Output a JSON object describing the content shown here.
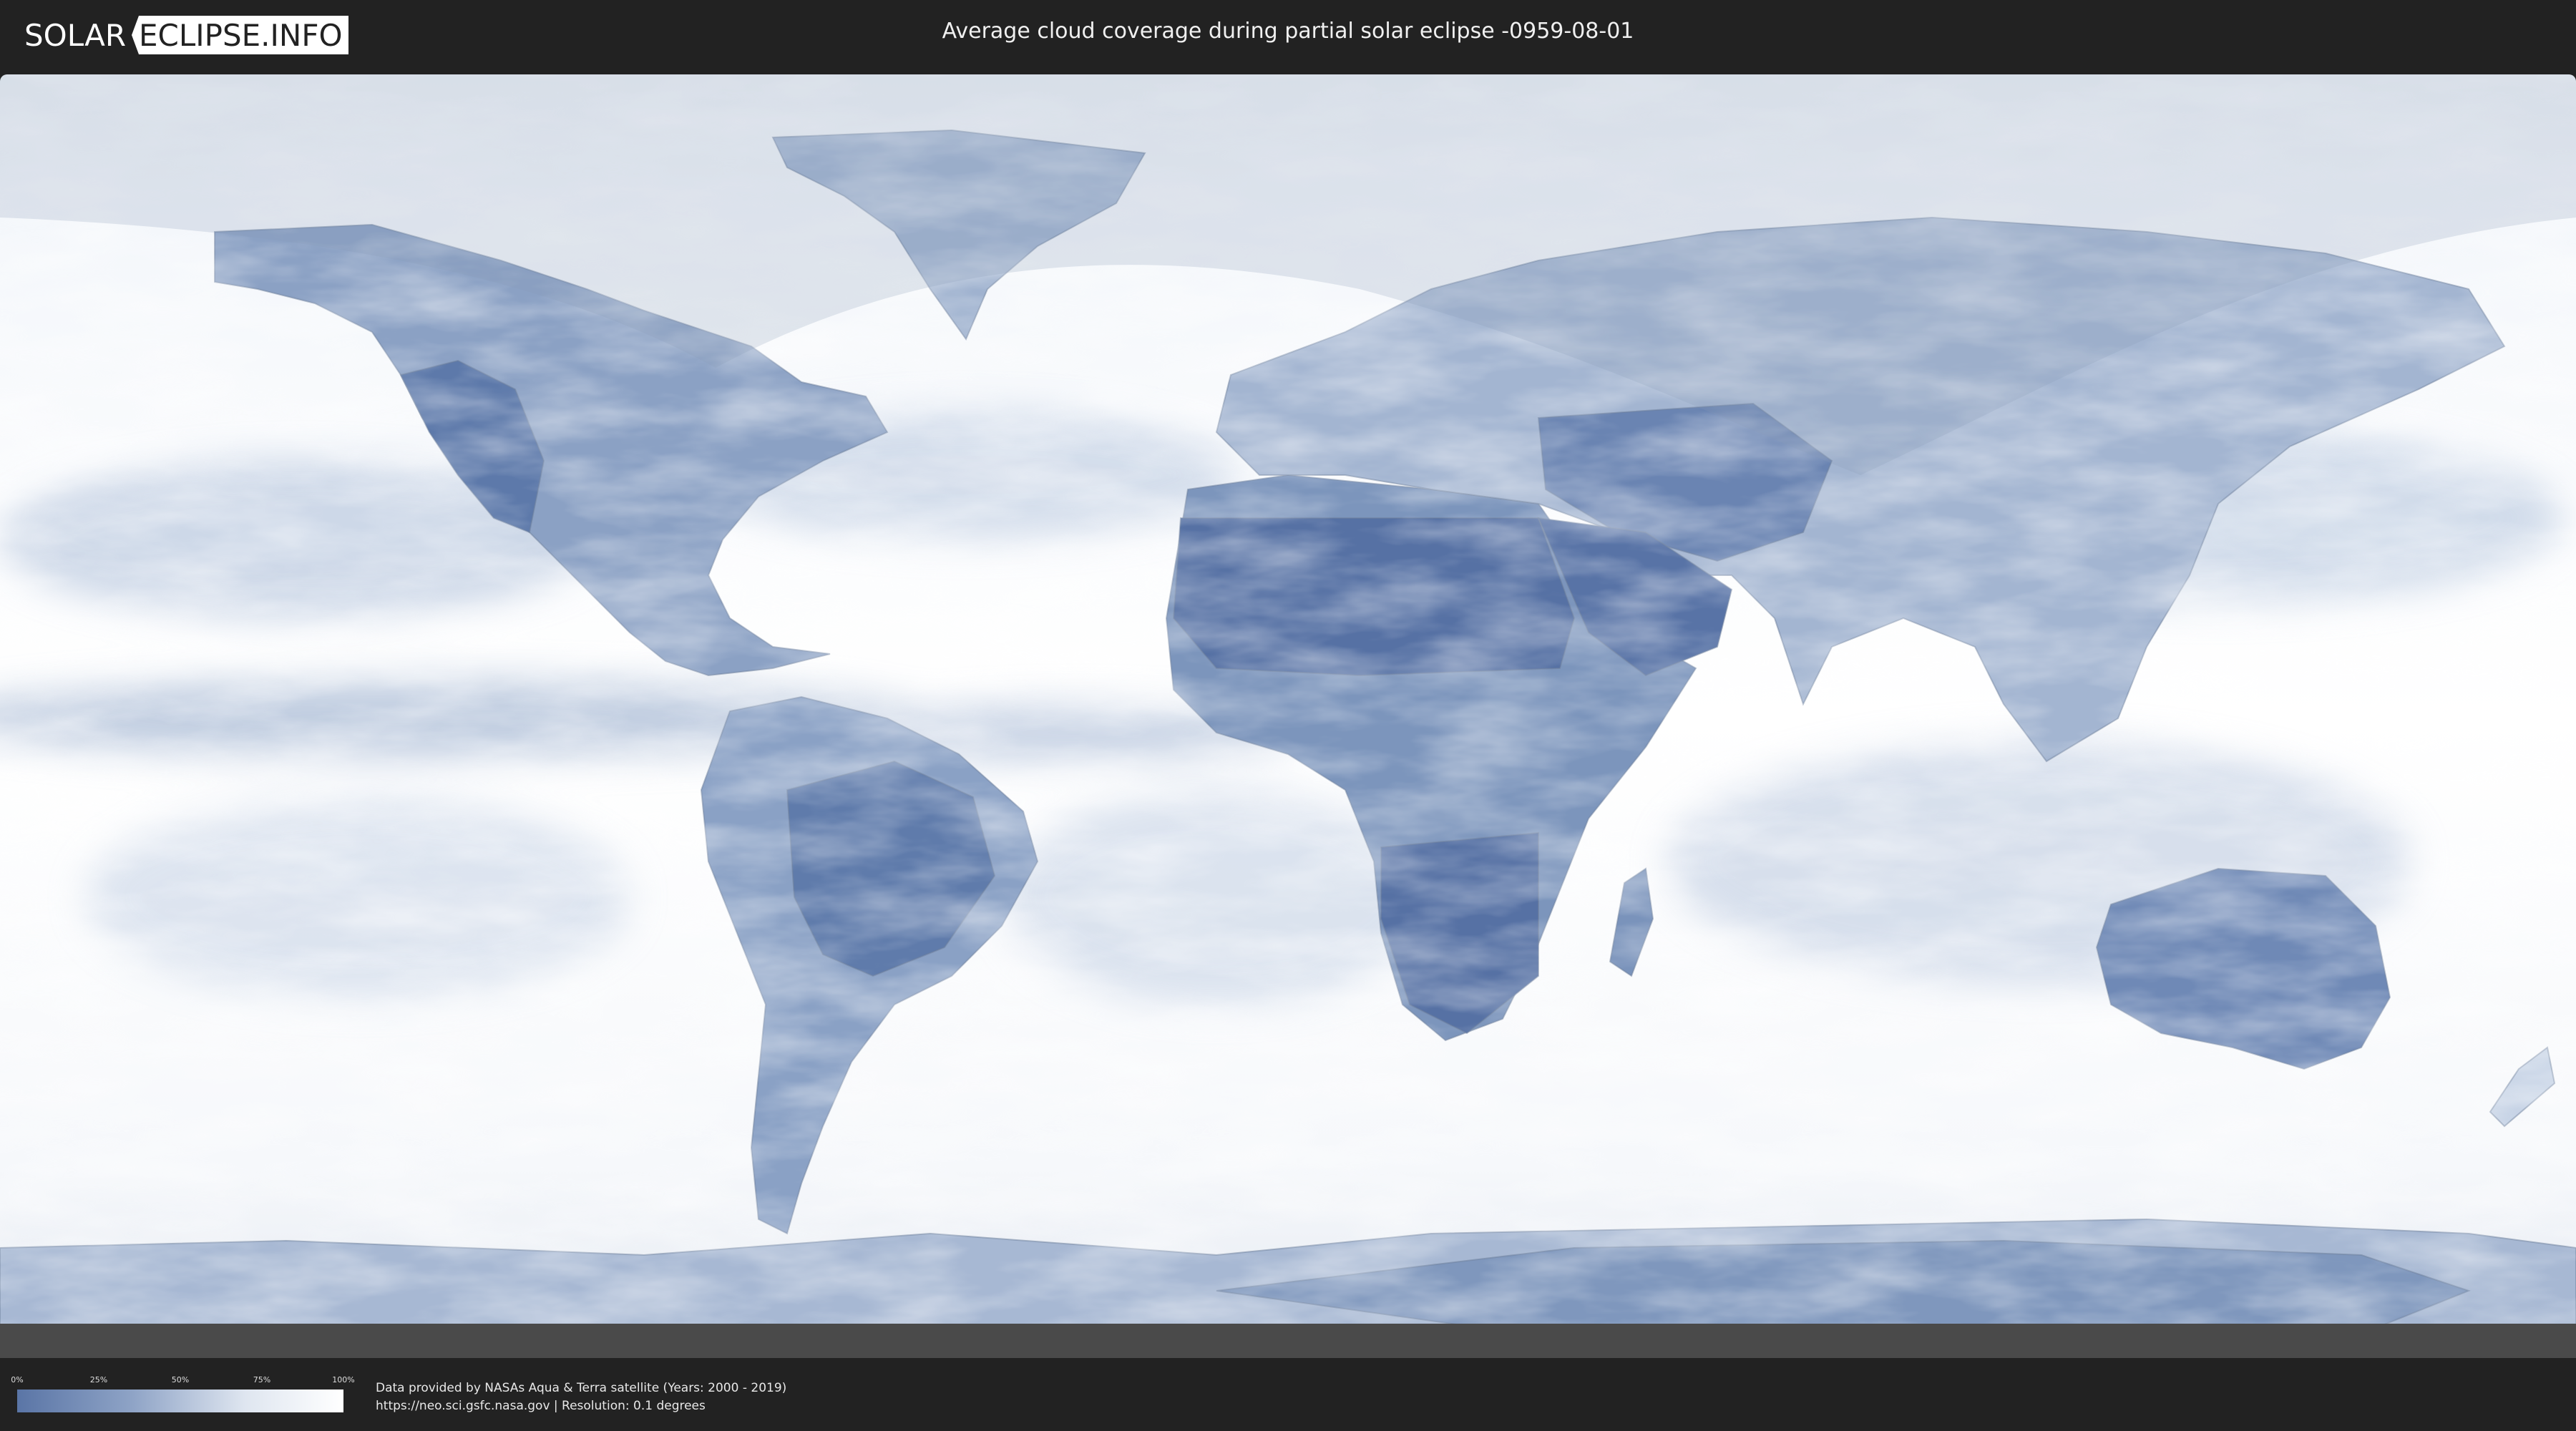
{
  "header": {
    "logo_left": "SOLAR",
    "logo_right": "ECLIPSE.INFO",
    "title": "Average cloud coverage during partial solar eclipse -0959-08-01"
  },
  "map": {
    "subject": "world cloud coverage",
    "colors": {
      "clear_sky": "#5a75a6",
      "cloudy": "#ffffff",
      "eclipse_shade": "#8a9ab5"
    },
    "cloud_scale_labels": [
      "0%",
      "25%",
      "50%",
      "75%",
      "100%"
    ]
  },
  "footer": {
    "credit_line": "Data provided by NASAs Aqua & Terra satellite (Years: 2000 - 2019)",
    "source_line": "https://neo.sci.gsfc.nasa.gov | Resolution: 0.1 degrees"
  }
}
